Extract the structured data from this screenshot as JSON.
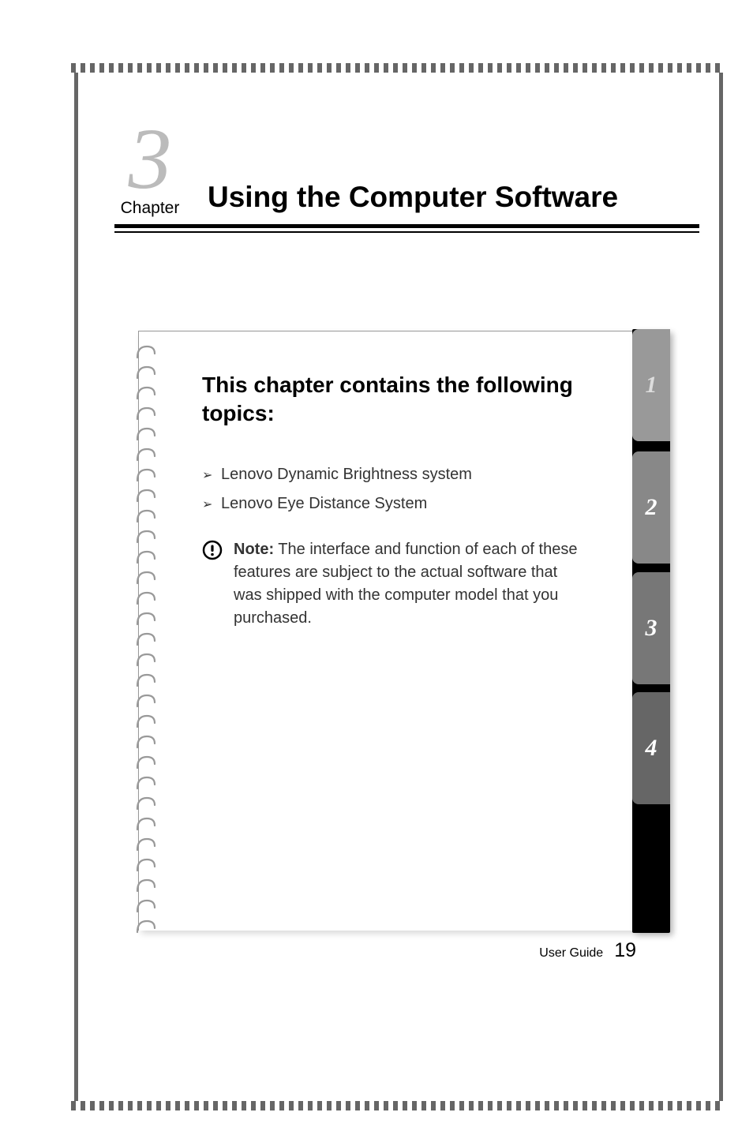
{
  "chapter": {
    "number": "3",
    "label": "Chapter",
    "title": "Using the Computer Software"
  },
  "contents": {
    "heading": "This chapter contains the following topics:",
    "topics": [
      "Lenovo Dynamic Brightness system",
      "Lenovo Eye Distance System"
    ],
    "note": {
      "label": "Note:",
      "text": " The interface and function of each of these features are subject to the actual software that was shipped with the computer model that you purchased."
    }
  },
  "tabs": [
    "1",
    "2",
    "3",
    "4"
  ],
  "footer": {
    "label": "User Guide",
    "page": "19"
  }
}
